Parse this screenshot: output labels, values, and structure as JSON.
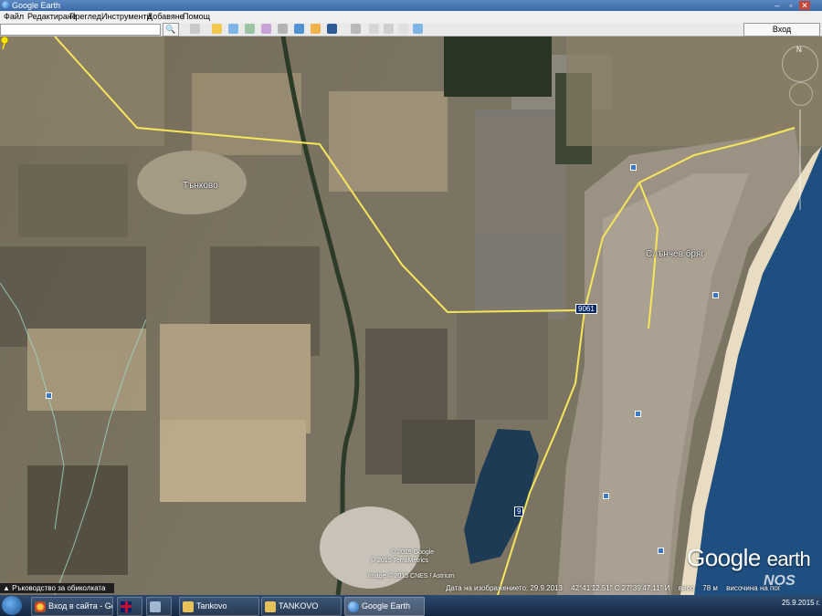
{
  "window": {
    "title": "Google Earth",
    "controls": {
      "min": "–",
      "max": "▫",
      "close": "✕"
    }
  },
  "menu": [
    "Файл",
    "Редактиране",
    "Преглед",
    "Инструменти",
    "Добавяне",
    "Помощ"
  ],
  "toolbar": {
    "search_icon": "search-icon",
    "search_glyph": "🔍",
    "signin_label": "Вход"
  },
  "map": {
    "labels": {
      "town_tankovo": "Тънково",
      "town_sunny_beach": "Слънчев бряг"
    },
    "road_shields": {
      "road_9061": "9061",
      "road_9": "9"
    },
    "copyrights": {
      "line1": "© 2015 Google",
      "line2": "© 2015 TerraMetrics",
      "line3": "Image © 2015 CNES / Astrium"
    },
    "logo_google": "Google",
    "logo_earth": "earth",
    "nav_guide": "Ръководство за обиколката",
    "status": {
      "date": "Дата на изображението: 29.9.2013",
      "coords": "42°41'12.51\" С  27°39'47.11\" И",
      "elev": "висо",
      "m": "78 м",
      "eye": "височина на пог"
    },
    "compass_n": "N"
  },
  "taskbar": {
    "tasks": [
      {
        "label": "Вход в сайта - Go...",
        "icon": "chrome-icon"
      },
      {
        "label": "",
        "icon": "uk-flag-icon"
      },
      {
        "label": "",
        "icon": "network-icon"
      },
      {
        "label": "Tankovo",
        "icon": "folder-icon"
      },
      {
        "label": "TANKOVO",
        "icon": "folder-icon"
      },
      {
        "label": "Google Earth",
        "icon": "google-earth-icon"
      }
    ],
    "clock_date": "25.9.2015 г."
  },
  "watermark": "NOS"
}
